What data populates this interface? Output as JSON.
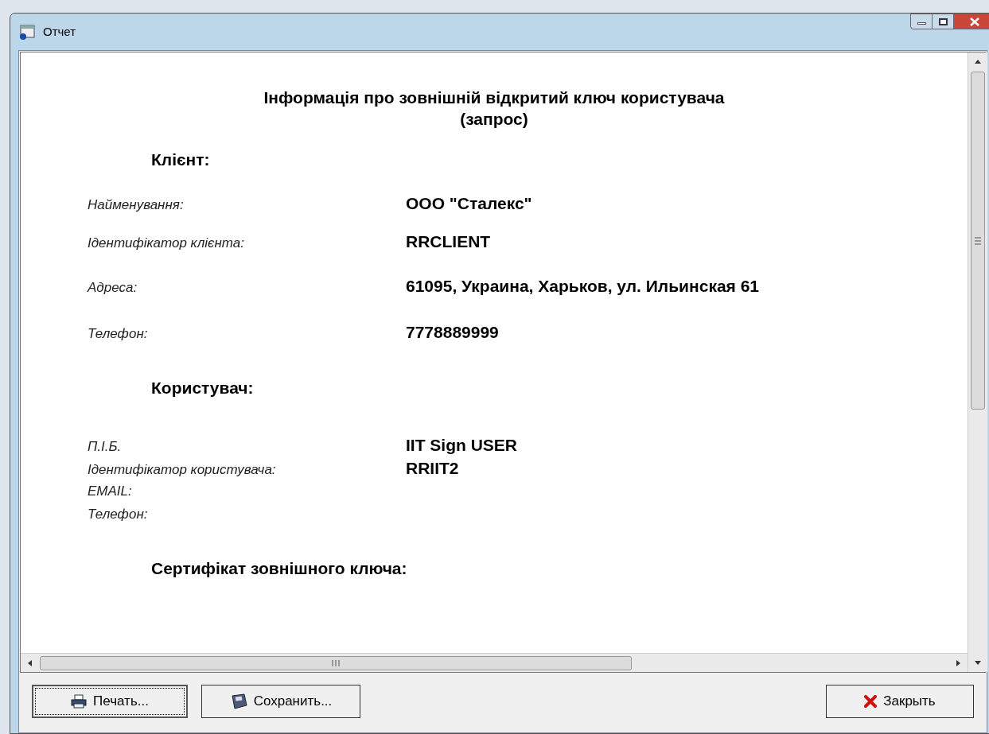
{
  "window": {
    "title": "Отчет"
  },
  "report": {
    "title": [
      "Інформація про зовнішній відкритий ключ користувача",
      "(запрос)"
    ],
    "sections": [
      {
        "heading": "Клієнт:",
        "kind": "spaced",
        "rows": [
          {
            "label": "Найменування:",
            "value": "ООО \"Сталекс\""
          },
          {
            "label": "Ідентифікатор клієнта:",
            "value": "RRCLIENT"
          },
          {
            "label": "Адреса:",
            "value": "61095, Украина, Харьков, ул. Ильинская 61"
          },
          {
            "label": "Телефон:",
            "value": "7778889999"
          }
        ]
      },
      {
        "heading": "Користувач:",
        "kind": "compact",
        "rows": [
          {
            "label": "П.І.Б.",
            "value": "IIT Sign USER"
          },
          {
            "label": "Ідентифікатор користувача:",
            "value": "RRIIT2"
          },
          {
            "label": "EMAIL:"
          },
          {
            "label": "Телефон:"
          }
        ]
      },
      {
        "heading": "Сертифікат зовнішного ключа:",
        "kind": "spaced"
      }
    ]
  },
  "buttons": [
    {
      "label": "Печать...",
      "kind": "print",
      "focused": true
    },
    {
      "label": "Сохранить...",
      "kind": "save",
      "focused": false
    },
    {
      "label": "Закрыть",
      "kind": "close",
      "focused": false
    }
  ]
}
